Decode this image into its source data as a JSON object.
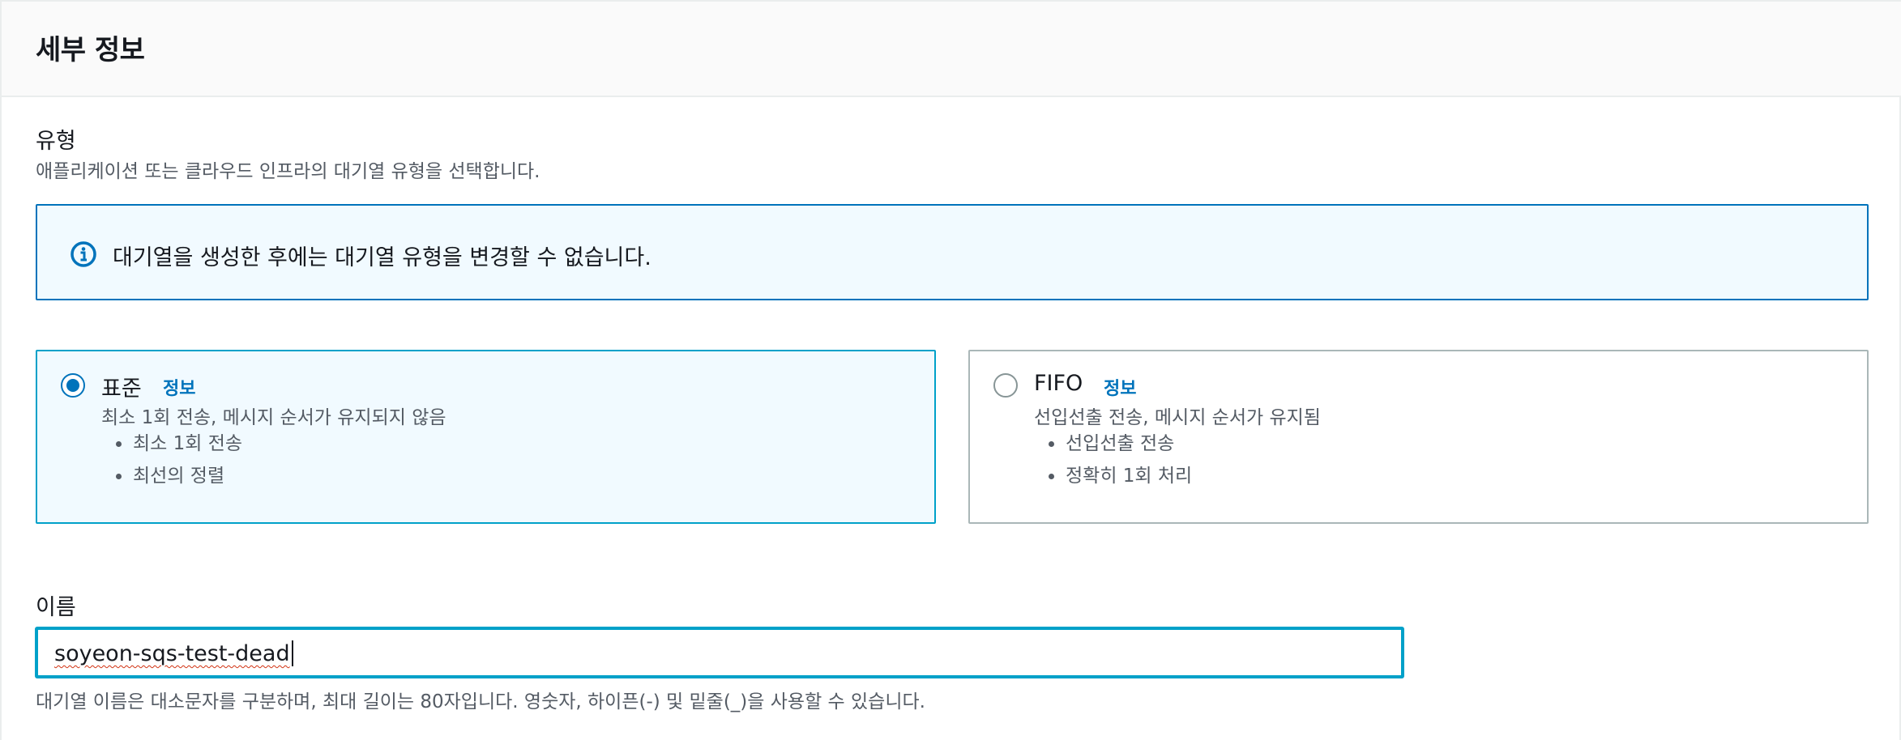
{
  "panel": {
    "title": "세부 정보"
  },
  "type_field": {
    "label": "유형",
    "description": "애플리케이션 또는 클라우드 인프라의 대기열 유형을 선택합니다.",
    "alert": {
      "icon": "info-icon",
      "text": "대기열을 생성한 후에는 대기열 유형을 변경할 수 없습니다."
    },
    "options": [
      {
        "title": "표준",
        "info_link": "정보",
        "selected": true,
        "description": "최소 1회 전송, 메시지 순서가 유지되지 않음",
        "bullets": [
          "최소 1회 전송",
          "최선의 정렬"
        ]
      },
      {
        "title": "FIFO",
        "info_link": "정보",
        "selected": false,
        "description": "선입선출 전송, 메시지 순서가 유지됨",
        "bullets": [
          "선입선출 전송",
          "정확히 1회 처리"
        ]
      }
    ]
  },
  "name_field": {
    "label": "이름",
    "value": "soyeon-sqs-test-dead",
    "constraint": "대기열 이름은 대소문자를 구분하며, 최대 길이는 80자입니다. 영숫자, 하이픈(-) 및 밑줄(_)을 사용할 수 있습니다."
  },
  "colors": {
    "accent": "#0073bb",
    "focus": "#00a1c9",
    "alert_bg": "#f1faff",
    "spellcheck": "#d13212"
  }
}
